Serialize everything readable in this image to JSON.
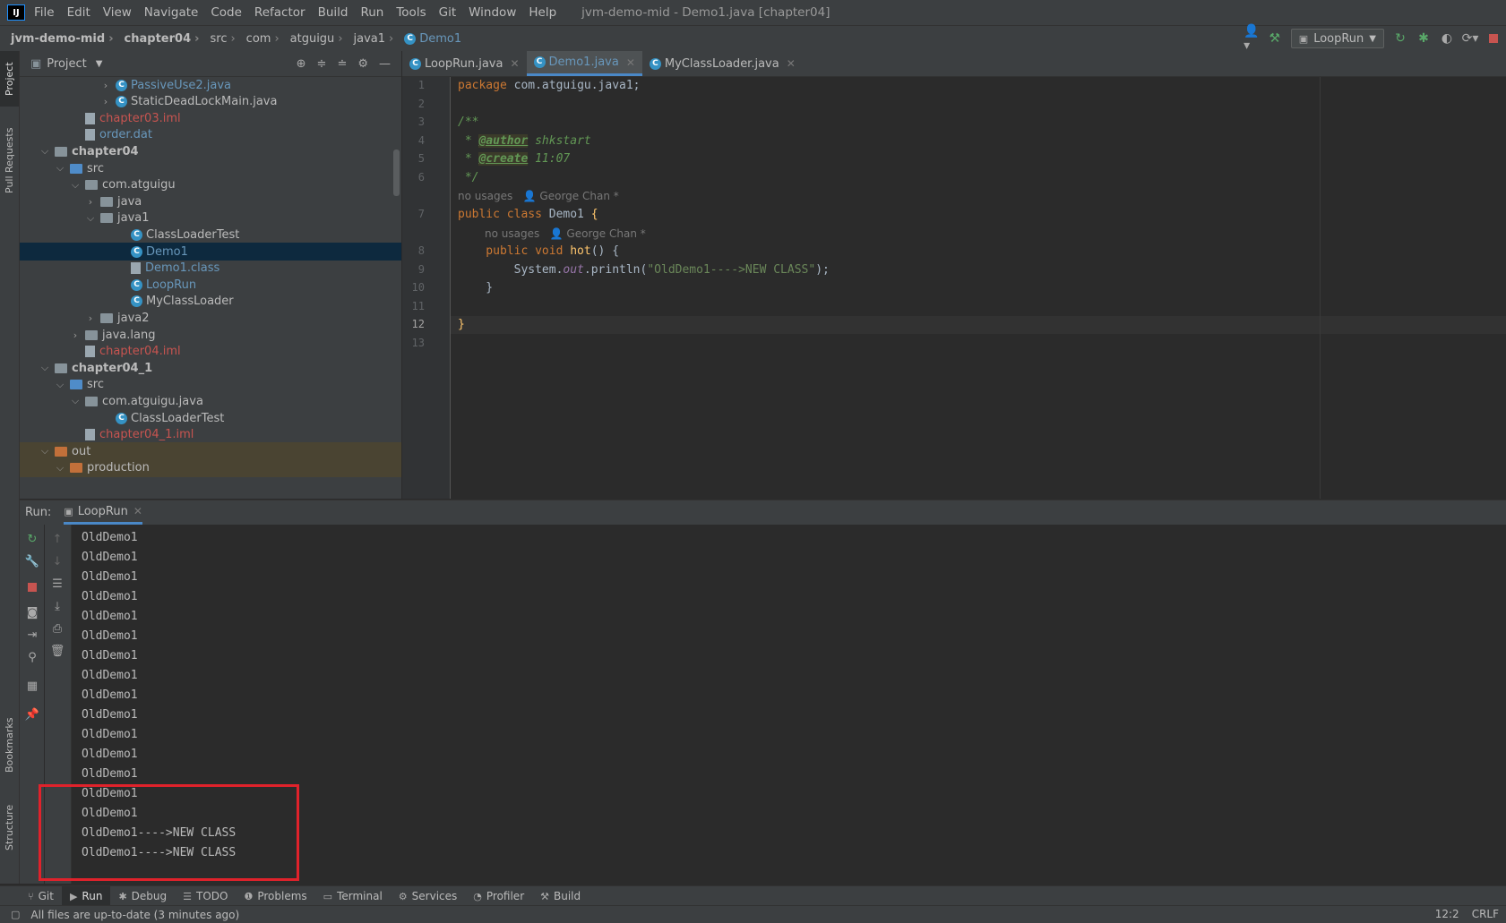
{
  "app": {
    "logo": "IJ",
    "window_title": "jvm-demo-mid - Demo1.java [chapter04]"
  },
  "menu": [
    "File",
    "Edit",
    "View",
    "Navigate",
    "Code",
    "Refactor",
    "Build",
    "Run",
    "Tools",
    "Git",
    "Window",
    "Help"
  ],
  "breadcrumb": [
    "jvm-demo-mid",
    "chapter04",
    "src",
    "com",
    "atguigu",
    "java1",
    "Demo1"
  ],
  "toolbar": {
    "run_config": "LoopRun",
    "icons": [
      "user-icon",
      "build-hammer-icon",
      "rerun-icon",
      "debug-icon",
      "coverage-icon",
      "profile-icon",
      "stop-icon"
    ]
  },
  "left_stripe": [
    "Project",
    "Pull Requests",
    "Bookmarks",
    "Structure"
  ],
  "project_panel": {
    "title": "Project",
    "tree": [
      {
        "label": "PassiveUse2.java",
        "depth": 5,
        "arrow": "›",
        "icon": "class",
        "color": "blue"
      },
      {
        "label": "StaticDeadLockMain.java",
        "depth": 5,
        "arrow": "›",
        "icon": "class",
        "color": "normal"
      },
      {
        "label": "chapter03.iml",
        "depth": 3,
        "arrow": "",
        "icon": "file",
        "color": "red"
      },
      {
        "label": "order.dat",
        "depth": 3,
        "arrow": "",
        "icon": "file",
        "color": "blue"
      },
      {
        "label": "chapter04",
        "depth": 1,
        "arrow": "⌄",
        "icon": "module",
        "color": "bold"
      },
      {
        "label": "src",
        "depth": 2,
        "arrow": "⌄",
        "icon": "folder-blue",
        "color": "normal"
      },
      {
        "label": "com.atguigu",
        "depth": 3,
        "arrow": "⌄",
        "icon": "folder",
        "color": "normal"
      },
      {
        "label": "java",
        "depth": 4,
        "arrow": "›",
        "icon": "folder",
        "color": "normal"
      },
      {
        "label": "java1",
        "depth": 4,
        "arrow": "⌄",
        "icon": "folder",
        "color": "normal"
      },
      {
        "label": "ClassLoaderTest",
        "depth": 6,
        "arrow": "",
        "icon": "class",
        "color": "normal"
      },
      {
        "label": "Demo1",
        "depth": 6,
        "arrow": "",
        "icon": "class",
        "color": "blue",
        "selected": true
      },
      {
        "label": "Demo1.class",
        "depth": 6,
        "arrow": "",
        "icon": "file",
        "color": "blue"
      },
      {
        "label": "LoopRun",
        "depth": 6,
        "arrow": "",
        "icon": "class",
        "color": "blue"
      },
      {
        "label": "MyClassLoader",
        "depth": 6,
        "arrow": "",
        "icon": "class",
        "color": "normal"
      },
      {
        "label": "java2",
        "depth": 4,
        "arrow": "›",
        "icon": "folder",
        "color": "normal"
      },
      {
        "label": "java.lang",
        "depth": 3,
        "arrow": "›",
        "icon": "folder",
        "color": "normal"
      },
      {
        "label": "chapter04.iml",
        "depth": 3,
        "arrow": "",
        "icon": "file",
        "color": "red"
      },
      {
        "label": "chapter04_1",
        "depth": 1,
        "arrow": "⌄",
        "icon": "module",
        "color": "bold"
      },
      {
        "label": "src",
        "depth": 2,
        "arrow": "⌄",
        "icon": "folder-blue",
        "color": "normal"
      },
      {
        "label": "com.atguigu.java",
        "depth": 3,
        "arrow": "⌄",
        "icon": "folder",
        "color": "normal"
      },
      {
        "label": "ClassLoaderTest",
        "depth": 5,
        "arrow": "",
        "icon": "class",
        "color": "normal"
      },
      {
        "label": "chapter04_1.iml",
        "depth": 3,
        "arrow": "",
        "icon": "file",
        "color": "red"
      },
      {
        "label": "out",
        "depth": 1,
        "arrow": "⌄",
        "icon": "folder-orange",
        "color": "normal",
        "excluded": true
      },
      {
        "label": "production",
        "depth": 2,
        "arrow": "⌄",
        "icon": "folder-orange",
        "color": "normal",
        "excluded": true
      }
    ]
  },
  "editor_tabs": [
    {
      "label": "LoopRun.java",
      "active": false
    },
    {
      "label": "Demo1.java",
      "active": true
    },
    {
      "label": "MyClassLoader.java",
      "active": false
    }
  ],
  "editor": {
    "line_numbers": [
      "1",
      "2",
      "3",
      "4",
      "5",
      "6",
      "7",
      "8",
      "9",
      "10",
      "11",
      "12",
      "13"
    ],
    "current_line": "12",
    "package_kw": "package",
    "package_name": " com.atguigu.java1;",
    "doc_open": "/**",
    "author_prefix": " * ",
    "author_tag": "@author",
    "author_value": " shkstart",
    "create_prefix": " * ",
    "create_tag": "@create",
    "create_value": " 11:07",
    "doc_close": " */",
    "inlay1": "no usages   👤 George Chan *",
    "class_kw": "public class ",
    "class_name": "Demo1",
    "class_brace": " {",
    "inlay2": "no usages   👤 George Chan *",
    "method_kw": "    public void ",
    "method_name": "hot",
    "method_rest": "() {",
    "print_a": "        System.",
    "print_out": "out",
    "print_b": ".println(",
    "print_str": "\"OldDemo1---->NEW CLASS\"",
    "print_c": ");",
    "method_close": "    }",
    "class_close": "}"
  },
  "run_panel": {
    "label": "Run:",
    "tab": "LoopRun",
    "output": [
      "OldDemo1",
      "OldDemo1",
      "OldDemo1",
      "OldDemo1",
      "OldDemo1",
      "OldDemo1",
      "OldDemo1",
      "OldDemo1",
      "OldDemo1",
      "OldDemo1",
      "OldDemo1",
      "OldDemo1",
      "OldDemo1",
      "OldDemo1",
      "OldDemo1",
      "OldDemo1---->NEW CLASS",
      "OldDemo1---->NEW CLASS"
    ]
  },
  "bottom_tools": [
    {
      "label": "Git",
      "icon": "git-icon"
    },
    {
      "label": "Run",
      "icon": "run-icon",
      "active": true
    },
    {
      "label": "Debug",
      "icon": "debug-icon"
    },
    {
      "label": "TODO",
      "icon": "todo-icon"
    },
    {
      "label": "Problems",
      "icon": "problems-icon"
    },
    {
      "label": "Terminal",
      "icon": "terminal-icon"
    },
    {
      "label": "Services",
      "icon": "services-icon"
    },
    {
      "label": "Profiler",
      "icon": "profiler-icon"
    },
    {
      "label": "Build",
      "icon": "build-icon"
    }
  ],
  "status": {
    "message": "All files are up-to-date (3 minutes ago)",
    "position": "12:2",
    "line_ending": "CRLF"
  },
  "colors": {
    "accent": "#4a88c7",
    "highlight_box": "#e0222b",
    "selection": "#0d293e"
  }
}
